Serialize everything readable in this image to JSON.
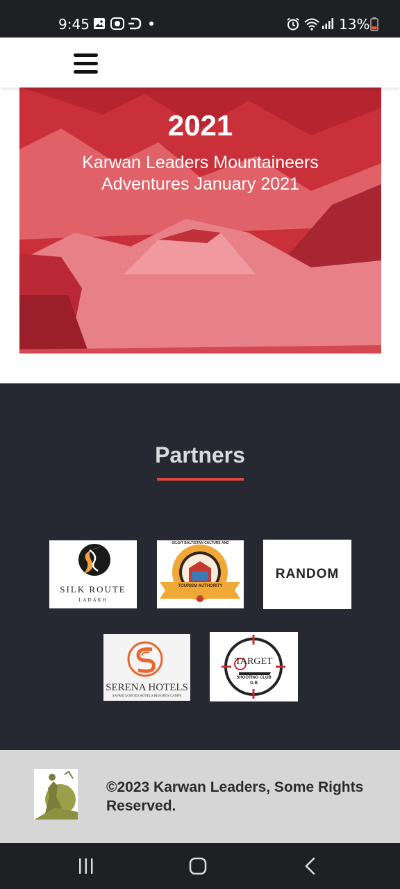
{
  "status_bar": {
    "time": "9:45",
    "battery_percent": "13%",
    "icons": [
      "gallery-icon",
      "coin-icon",
      "d-app-icon",
      "dot-icon",
      "alarm-icon",
      "wifi-icon",
      "signal-icon",
      "battery-icon"
    ]
  },
  "header": {
    "menu_icon": "hamburger-menu-icon"
  },
  "hero": {
    "year": "2021",
    "title": "Karwan Leaders Mountaineers Adventures January 2021",
    "overlay_color": "#d6313c"
  },
  "partners": {
    "heading": "Partners",
    "accent_color": "#e0473d",
    "background_color": "#262931",
    "logos": [
      {
        "name": "Silk Route Ladakh",
        "text_line1": "SILK ROUTE",
        "text_line2": "LADAKH"
      },
      {
        "name": "Gilgit Baltistan Culture and Tourism Authority",
        "ring_text": "GILGIT BALTISTAN CULTURE AND",
        "ribbon_text": "TOURISM AUTHORITY"
      },
      {
        "name": "Random",
        "text": "RANDOM"
      },
      {
        "name": "Serena Hotels",
        "text": "SERENA HOTELS",
        "subtext": "SAFARI LODGES HOTELS RESORTS CAMPS"
      },
      {
        "name": "Target Shooting Club G-B",
        "text": "TARGET",
        "subtext": "SHOOTING CLUB",
        "subtext2": "G-B"
      }
    ]
  },
  "footer": {
    "copyright": "©2023 Karwan Leaders, Some Rights Reserved."
  },
  "nav_bar": {
    "buttons": [
      "recent-apps-icon",
      "home-icon",
      "back-icon"
    ]
  }
}
